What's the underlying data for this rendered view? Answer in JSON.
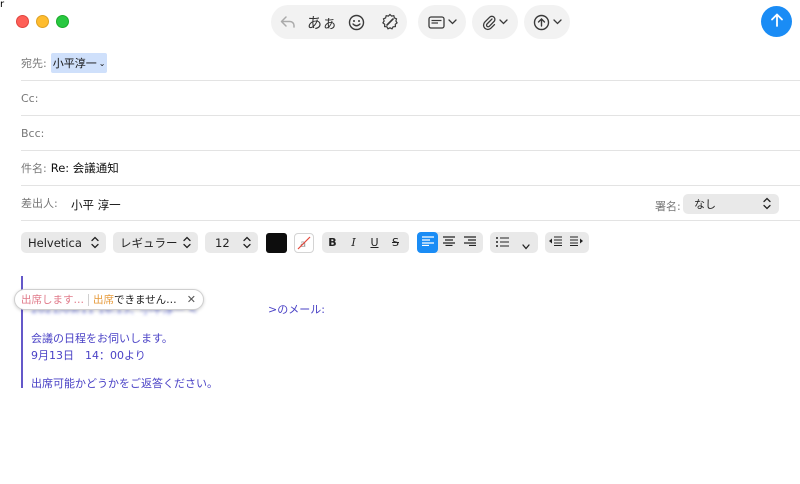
{
  "toolbar": {
    "format_text_label": "あぁ",
    "icons": [
      "reply-icon",
      "format-text-icon",
      "emoji-icon",
      "markup-icon",
      "header-fields-icon",
      "attach-icon",
      "photo-browser-icon",
      "send-icon"
    ]
  },
  "header": {
    "to_label": "宛先:",
    "to_recipient": "小平淳一",
    "cc_label": "Cc:",
    "bcc_label": "Bcc:",
    "subject_label": "件名:",
    "subject_value": "Re: 会議通知",
    "from_label": "差出人:",
    "from_value": "小平 淳一",
    "signature_label": "署名:",
    "signature_value": "なし"
  },
  "format_bar": {
    "font": "Helvetica",
    "weight": "レギュラー",
    "size": "12",
    "bold": "B",
    "italic": "I",
    "underline": "U",
    "strike": "S"
  },
  "body": {
    "quote_header_prefix": "2021/09/11 16:13、小平淳一 <",
    "quote_header_suffix": ">のメール:",
    "line1": "会議の日程をお伺いします。",
    "line2": "9月13日　14：00より",
    "line3": "出席可能かどうかをご返答ください。"
  },
  "suggestions": {
    "option1": "出席します…",
    "option2_highlight": "出席",
    "option2_rest": "できません…"
  },
  "colors": {
    "accent": "#1a8cf5",
    "quote": "#4a42c6",
    "token_bg": "#cfe0fb"
  }
}
